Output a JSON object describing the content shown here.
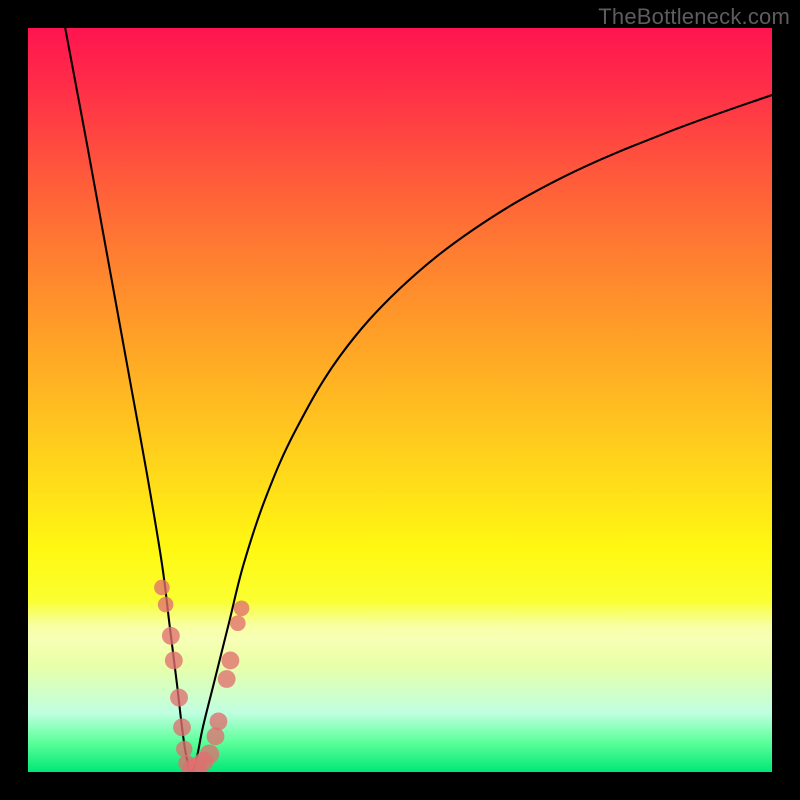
{
  "watermark": "TheBottleneck.com",
  "colors": {
    "frame": "#000000",
    "curve": "#000000",
    "marker": "#e07070"
  },
  "chart_data": {
    "type": "line",
    "title": "",
    "xlabel": "",
    "ylabel": "",
    "xlim": [
      0,
      100
    ],
    "ylim": [
      0,
      100
    ],
    "grid": false,
    "series": [
      {
        "name": "bottleneck-curve",
        "x": [
          5,
          8,
          10,
          12,
          14,
          16,
          18,
          19,
          20,
          20.7,
          21.3,
          22,
          22.7,
          23.5,
          25,
          27,
          29,
          32,
          36,
          42,
          50,
          60,
          72,
          86,
          100
        ],
        "y": [
          100,
          84,
          73,
          62,
          51,
          40,
          28,
          20,
          12,
          6,
          2,
          0,
          2,
          6,
          12,
          20,
          28,
          37,
          46,
          56,
          65,
          73,
          80,
          86,
          91
        ]
      }
    ],
    "markers": [
      {
        "x": 18.0,
        "y": 24.8,
        "r": 1.05
      },
      {
        "x": 18.5,
        "y": 22.5,
        "r": 1.05
      },
      {
        "x": 19.2,
        "y": 18.3,
        "r": 1.2
      },
      {
        "x": 19.6,
        "y": 15.0,
        "r": 1.2
      },
      {
        "x": 20.3,
        "y": 10.0,
        "r": 1.2
      },
      {
        "x": 20.7,
        "y": 6.0,
        "r": 1.2
      },
      {
        "x": 21.0,
        "y": 3.1,
        "r": 1.1
      },
      {
        "x": 21.3,
        "y": 1.2,
        "r": 1.1
      },
      {
        "x": 22.0,
        "y": 0.4,
        "r": 1.3
      },
      {
        "x": 22.8,
        "y": 0.8,
        "r": 1.3
      },
      {
        "x": 23.6,
        "y": 1.4,
        "r": 1.3
      },
      {
        "x": 24.4,
        "y": 2.4,
        "r": 1.3
      },
      {
        "x": 25.2,
        "y": 4.8,
        "r": 1.2
      },
      {
        "x": 25.6,
        "y": 6.8,
        "r": 1.2
      },
      {
        "x": 26.7,
        "y": 12.5,
        "r": 1.2
      },
      {
        "x": 27.2,
        "y": 15.0,
        "r": 1.2
      },
      {
        "x": 28.2,
        "y": 20.0,
        "r": 1.05
      },
      {
        "x": 28.7,
        "y": 22.0,
        "r": 1.05
      }
    ]
  }
}
